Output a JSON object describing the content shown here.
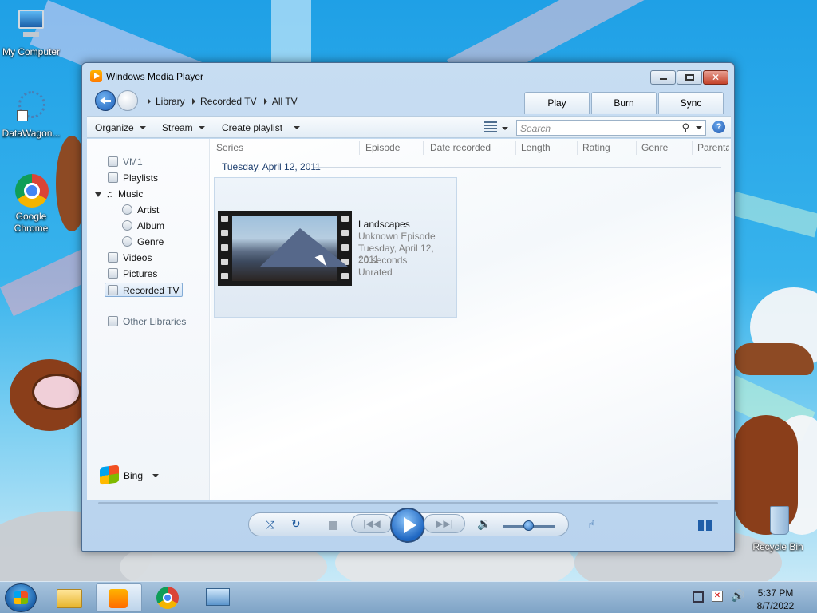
{
  "desktop": {
    "icons": [
      {
        "label": "My Computer"
      },
      {
        "label": "DataWagon..."
      },
      {
        "label": "Google\nChrome"
      },
      {
        "label": "Recycle Bin"
      }
    ]
  },
  "window": {
    "title": "Windows Media Player",
    "breadcrumbs": [
      "Library",
      "Recorded TV",
      "All TV"
    ],
    "tabs": [
      {
        "label": "Play"
      },
      {
        "label": "Burn"
      },
      {
        "label": "Sync"
      }
    ],
    "toolbar": {
      "organize": "Organize",
      "stream": "Stream",
      "create_playlist": "Create playlist",
      "search_placeholder": "Search",
      "help": "?"
    },
    "nav": {
      "vm": "VM1",
      "playlists": "Playlists",
      "music": "Music",
      "artist": "Artist",
      "album": "Album",
      "genre": "Genre",
      "videos": "Videos",
      "pictures": "Pictures",
      "recorded_tv": "Recorded TV",
      "other_libraries": "Other Libraries",
      "bing": "Bing"
    },
    "columns": [
      "Series",
      "Episode",
      "Date recorded",
      "Length",
      "Rating",
      "Genre",
      "Parenta"
    ],
    "group_header": "Tuesday, April 12, 2011",
    "item": {
      "title": "Landscapes",
      "episode": "Unknown Episode",
      "date": "Tuesday, April 12, 2011",
      "length": "10 seconds",
      "rating": "Unrated"
    },
    "volume_level": 0.5
  },
  "taskbar": {
    "time": "5:37 PM",
    "date": "8/7/2022"
  }
}
